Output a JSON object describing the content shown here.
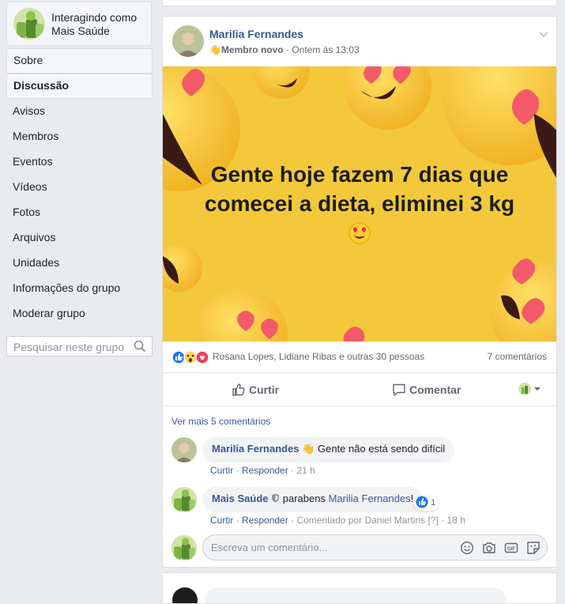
{
  "acting_as": {
    "line1": "Interagindo como",
    "line2": "Mais Saúde"
  },
  "nav": [
    {
      "label": "Sobre",
      "name": "nav-sobre"
    },
    {
      "label": "Discussão",
      "name": "nav-discussao"
    },
    {
      "label": "Avisos",
      "name": "nav-avisos"
    },
    {
      "label": "Membros",
      "name": "nav-membros"
    },
    {
      "label": "Eventos",
      "name": "nav-eventos"
    },
    {
      "label": "Vídeos",
      "name": "nav-videos"
    },
    {
      "label": "Fotos",
      "name": "nav-fotos"
    },
    {
      "label": "Arquivos",
      "name": "nav-arquivos"
    },
    {
      "label": "Unidades",
      "name": "nav-unidades"
    },
    {
      "label": "Informações do grupo",
      "name": "nav-informacoes"
    },
    {
      "label": "Moderar grupo",
      "name": "nav-moderar"
    }
  ],
  "group_search": {
    "placeholder": "Pesquisar neste grupo"
  },
  "post": {
    "author": "Marilia Fernandes",
    "badge": "Membro novo",
    "time": "Ontem às 13:03",
    "text_line1": "Gente hoje fazem 7 dias que",
    "text_line2": "comecei a dieta, eliminei 3 kg",
    "reactions_text": "Rosana Lopes, Lidiane Ribas e outras 30 pessoas",
    "comments_count": "7 comentários",
    "like_label": "Curtir",
    "comment_label": "Comentar",
    "more_comments": "Ver mais 5 comentários"
  },
  "comments": [
    {
      "author": "Marilia Fernandes",
      "text": "Gente não está sendo difícil",
      "like": "Curtir",
      "reply": "Responder",
      "time": "21 h"
    },
    {
      "author": "Mais Saúde",
      "text": "parabens",
      "mention": "Marilia Fernandes",
      "suffix": "!",
      "like": "Curtir",
      "reply": "Responder",
      "commented_by": "Comentado por Daniel Martins",
      "help": "[?]",
      "time": "18 h",
      "likes": "1"
    }
  ],
  "composer": {
    "placeholder": "Escreva um comentário..."
  },
  "colors": {
    "link": "#385898",
    "banner": "#f3c83a",
    "like_blue": "#1877f2",
    "love_red": "#f33e58"
  }
}
